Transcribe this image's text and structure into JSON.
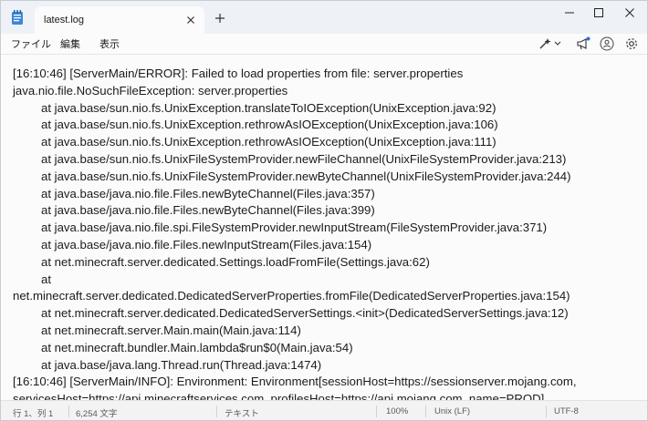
{
  "tab": {
    "title": "latest.log"
  },
  "menu": {
    "file": "ファイル",
    "edit": "編集",
    "view": "表示"
  },
  "log_lines": [
    {
      "text": "[16:10:46] [ServerMain/ERROR]: Failed to load properties from file: server.properties",
      "indent": false
    },
    {
      "text": "java.nio.file.NoSuchFileException: server.properties",
      "indent": false
    },
    {
      "text": "at java.base/sun.nio.fs.UnixException.translateToIOException(UnixException.java:92)",
      "indent": true
    },
    {
      "text": "at java.base/sun.nio.fs.UnixException.rethrowAsIOException(UnixException.java:106)",
      "indent": true
    },
    {
      "text": "at java.base/sun.nio.fs.UnixException.rethrowAsIOException(UnixException.java:111)",
      "indent": true
    },
    {
      "text": "at java.base/sun.nio.fs.UnixFileSystemProvider.newFileChannel(UnixFileSystemProvider.java:213)",
      "indent": true
    },
    {
      "text": "at java.base/sun.nio.fs.UnixFileSystemProvider.newByteChannel(UnixFileSystemProvider.java:244)",
      "indent": true
    },
    {
      "text": "at java.base/java.nio.file.Files.newByteChannel(Files.java:357)",
      "indent": true
    },
    {
      "text": "at java.base/java.nio.file.Files.newByteChannel(Files.java:399)",
      "indent": true
    },
    {
      "text": "at java.base/java.nio.file.spi.FileSystemProvider.newInputStream(FileSystemProvider.java:371)",
      "indent": true
    },
    {
      "text": "at java.base/java.nio.file.Files.newInputStream(Files.java:154)",
      "indent": true
    },
    {
      "text": "at net.minecraft.server.dedicated.Settings.loadFromFile(Settings.java:62)",
      "indent": true
    },
    {
      "text": "at",
      "indent": true
    },
    {
      "text": "net.minecraft.server.dedicated.DedicatedServerProperties.fromFile(DedicatedServerProperties.java:154)",
      "indent": false
    },
    {
      "text": "at net.minecraft.server.dedicated.DedicatedServerSettings.<init>(DedicatedServerSettings.java:12)",
      "indent": true
    },
    {
      "text": "at net.minecraft.server.Main.main(Main.java:114)",
      "indent": true
    },
    {
      "text": "at net.minecraft.bundler.Main.lambda$run$0(Main.java:54)",
      "indent": true
    },
    {
      "text": "at java.base/java.lang.Thread.run(Thread.java:1474)",
      "indent": true
    },
    {
      "text": "[16:10:46] [ServerMain/INFO]: Environment: Environment[sessionHost=https://sessionserver.mojang.com,",
      "indent": false
    },
    {
      "text": "servicesHost=https://api.minecraftservices.com, profilesHost=https://api.mojang.com, name=PROD]",
      "indent": false
    }
  ],
  "status": {
    "position": "行 1、列 1",
    "chars": "6,254 文字",
    "format": "テキスト",
    "zoom": "100%",
    "line_ending": "Unix (LF)",
    "encoding": "UTF-8"
  }
}
